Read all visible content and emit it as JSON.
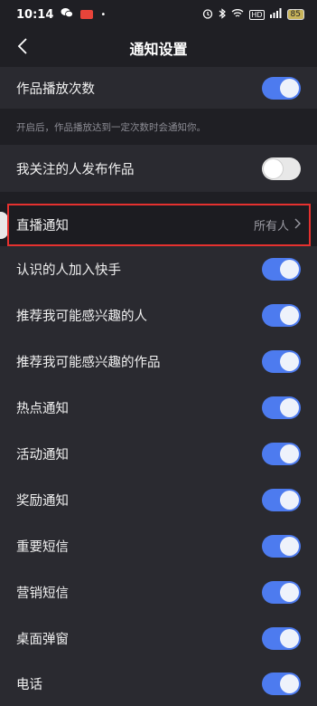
{
  "status_bar": {
    "time": "10:14",
    "battery": "85",
    "network": "HD"
  },
  "header": {
    "title": "通知设置"
  },
  "settings": {
    "play_count": {
      "label": "作品播放次数",
      "enabled": true
    },
    "play_count_desc": "开启后，作品播放达到一定次数时会通知你。",
    "following_publish": {
      "label": "我关注的人发布作品",
      "enabled": false
    },
    "live_notify": {
      "label": "直播通知",
      "value": "所有人"
    },
    "items": [
      {
        "label": "认识的人加入快手",
        "enabled": true
      },
      {
        "label": "推荐我可能感兴趣的人",
        "enabled": true
      },
      {
        "label": "推荐我可能感兴趣的作品",
        "enabled": true
      },
      {
        "label": "热点通知",
        "enabled": true
      },
      {
        "label": "活动通知",
        "enabled": true
      },
      {
        "label": "奖励通知",
        "enabled": true
      },
      {
        "label": "重要短信",
        "enabled": true
      },
      {
        "label": "营销短信",
        "enabled": true
      },
      {
        "label": "桌面弹窗",
        "enabled": true
      },
      {
        "label": "电话",
        "enabled": true
      }
    ]
  },
  "colors": {
    "toggle_on": "#4d7bef",
    "highlight": "#e5312f",
    "background": "#1f1f24",
    "row_background": "#2a2a30"
  }
}
